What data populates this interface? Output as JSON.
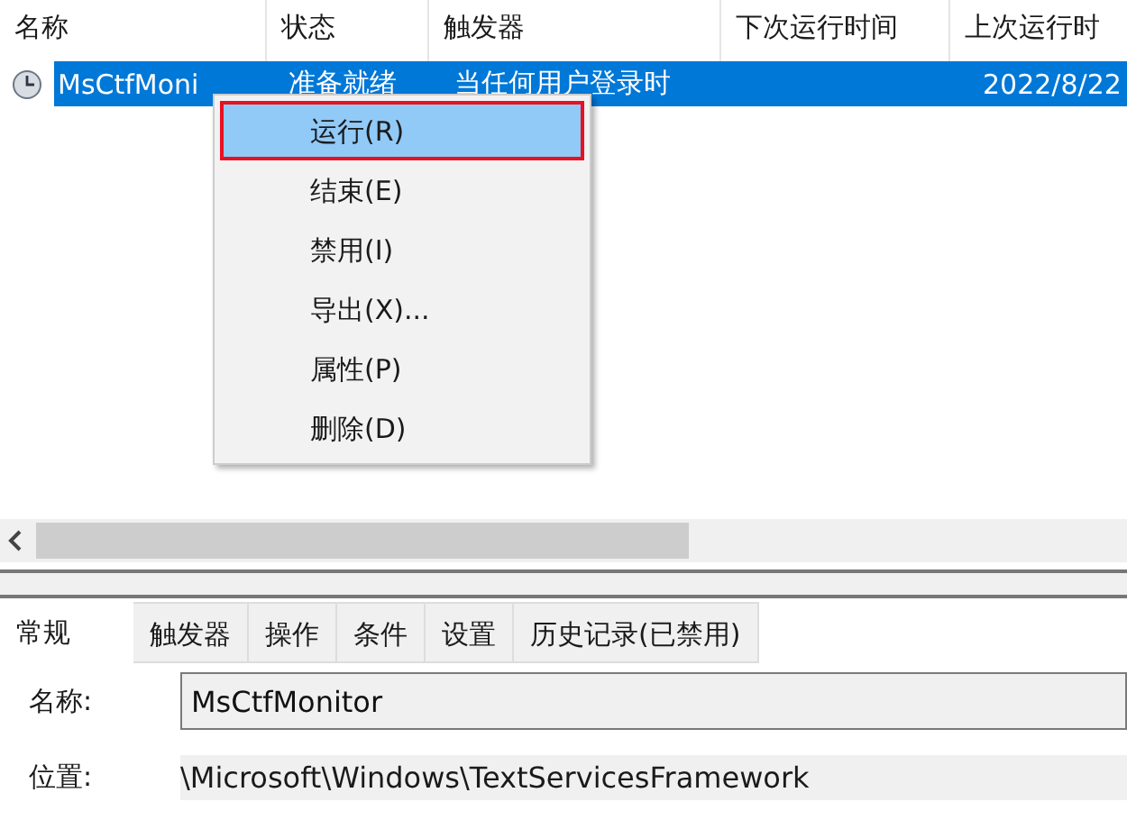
{
  "table": {
    "columns": [
      "名称",
      "状态",
      "触发器",
      "下次运行时间",
      "上次运行时"
    ],
    "rows": [
      {
        "name": "MsCtfMoni",
        "status": "准备就绪",
        "trigger": "当任何用户登录时",
        "next_run": "",
        "last_run": "2022/8/22",
        "selected": true
      }
    ]
  },
  "context_menu": [
    {
      "label": "运行(R)",
      "selected": true
    },
    {
      "label": "结束(E)",
      "selected": false
    },
    {
      "label": "禁用(I)",
      "selected": false
    },
    {
      "label": "导出(X)...",
      "selected": false
    },
    {
      "label": "属性(P)",
      "selected": false
    },
    {
      "label": "删除(D)",
      "selected": false
    }
  ],
  "tabs": [
    {
      "label": "常规",
      "selected": true
    },
    {
      "label": "触发器",
      "selected": false
    },
    {
      "label": "操作",
      "selected": false
    },
    {
      "label": "条件",
      "selected": false
    },
    {
      "label": "设置",
      "selected": false
    },
    {
      "label": "历史记录(已禁用)",
      "selected": false
    }
  ],
  "fields": [
    {
      "label": "名称:",
      "value": "MsCtfMonitor",
      "kind": "input"
    },
    {
      "label": "位置:",
      "value": "\\Microsoft\\Windows\\TextServicesFramework",
      "kind": "readonly"
    }
  ]
}
